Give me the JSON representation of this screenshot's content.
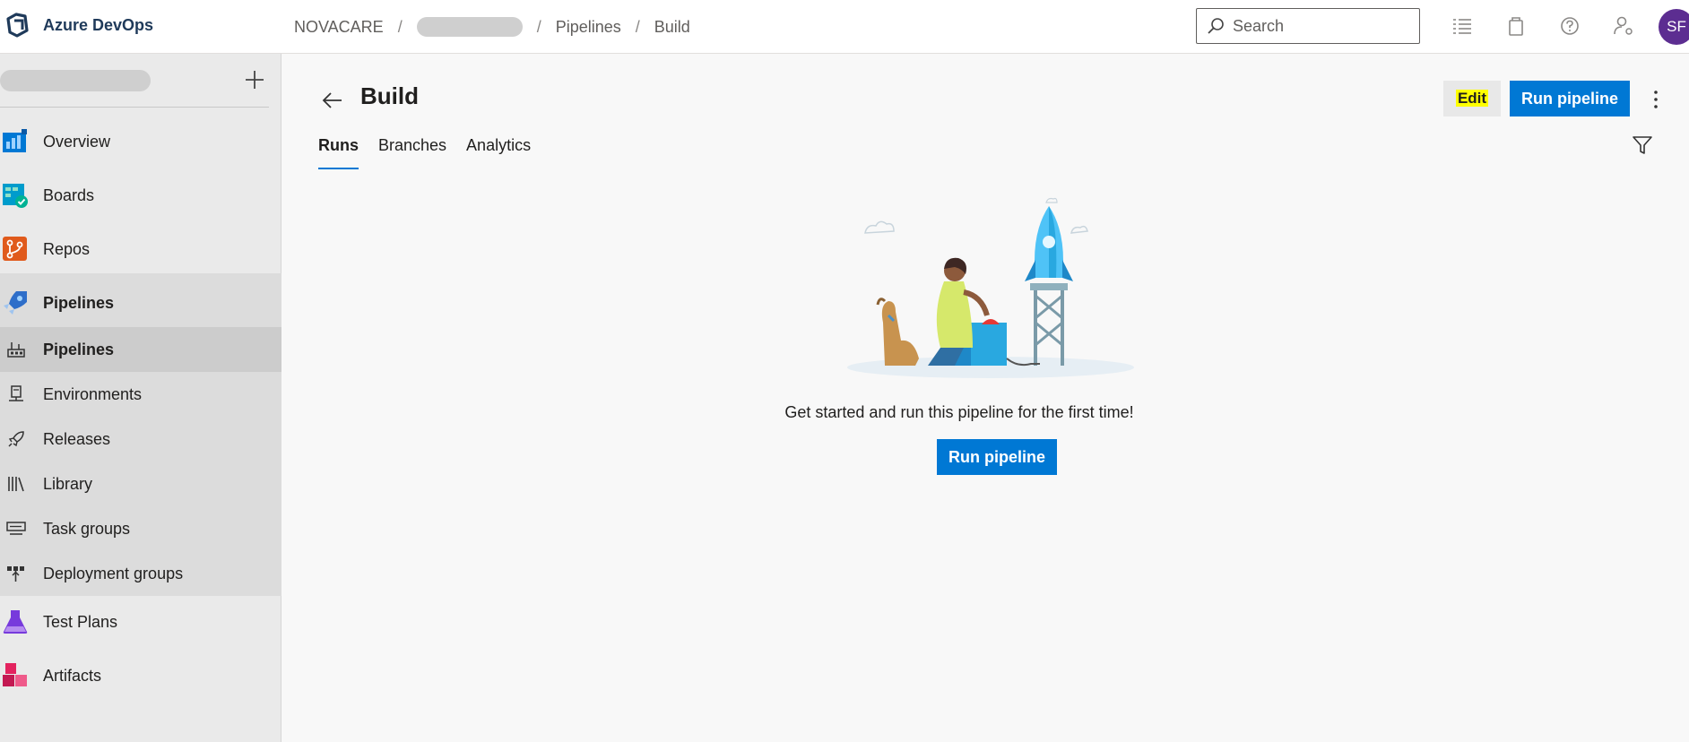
{
  "app": {
    "name": "Azure DevOps"
  },
  "breadcrumb": {
    "org": "NOVACARE",
    "section": "Pipelines",
    "page": "Build",
    "separator": "/"
  },
  "search": {
    "placeholder": "Search",
    "value": ""
  },
  "user": {
    "initials": "SF"
  },
  "sidebar": {
    "items": [
      {
        "label": "Overview"
      },
      {
        "label": "Boards"
      },
      {
        "label": "Repos"
      },
      {
        "label": "Pipelines"
      },
      {
        "label": "Pipelines"
      },
      {
        "label": "Environments"
      },
      {
        "label": "Releases"
      },
      {
        "label": "Library"
      },
      {
        "label": "Task groups"
      },
      {
        "label": "Deployment groups"
      },
      {
        "label": "Test Plans"
      },
      {
        "label": "Artifacts"
      }
    ]
  },
  "main": {
    "title": "Build",
    "tabs": [
      {
        "label": "Runs"
      },
      {
        "label": "Branches"
      },
      {
        "label": "Analytics"
      }
    ],
    "edit_label": "Edit",
    "run_label": "Run pipeline",
    "empty_message": "Get started and run this pipeline for the first time!",
    "empty_run_label": "Run pipeline"
  },
  "colors": {
    "accent": "#0078d4",
    "avatar": "#5c2d91",
    "edit_highlight": "#ffff00"
  }
}
